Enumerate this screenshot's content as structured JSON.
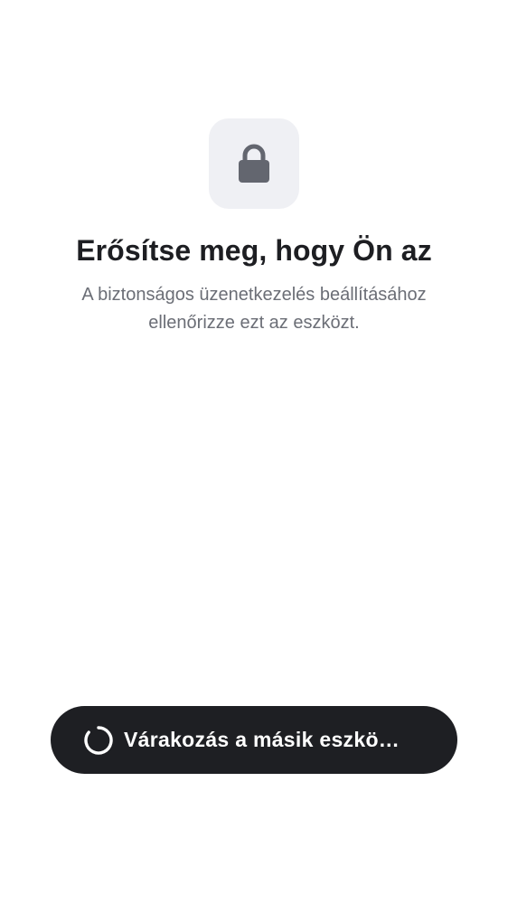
{
  "verify": {
    "icon": "lock-icon",
    "title": "Erősítse meg, hogy Ön az",
    "subtitle": "A biztonságos üzenetkezelés beállításához ellenőrizze ezt az eszközt."
  },
  "wait_button": {
    "icon": "spinner-icon",
    "label": "Várakozás a másik eszkö…"
  },
  "colors": {
    "background": "#ffffff",
    "tile": "#eff0f4",
    "lock": "#63666f",
    "title": "#1d1e22",
    "subtitle": "#6b6e76",
    "button": "#1e1f23",
    "button_text": "#ffffff"
  }
}
